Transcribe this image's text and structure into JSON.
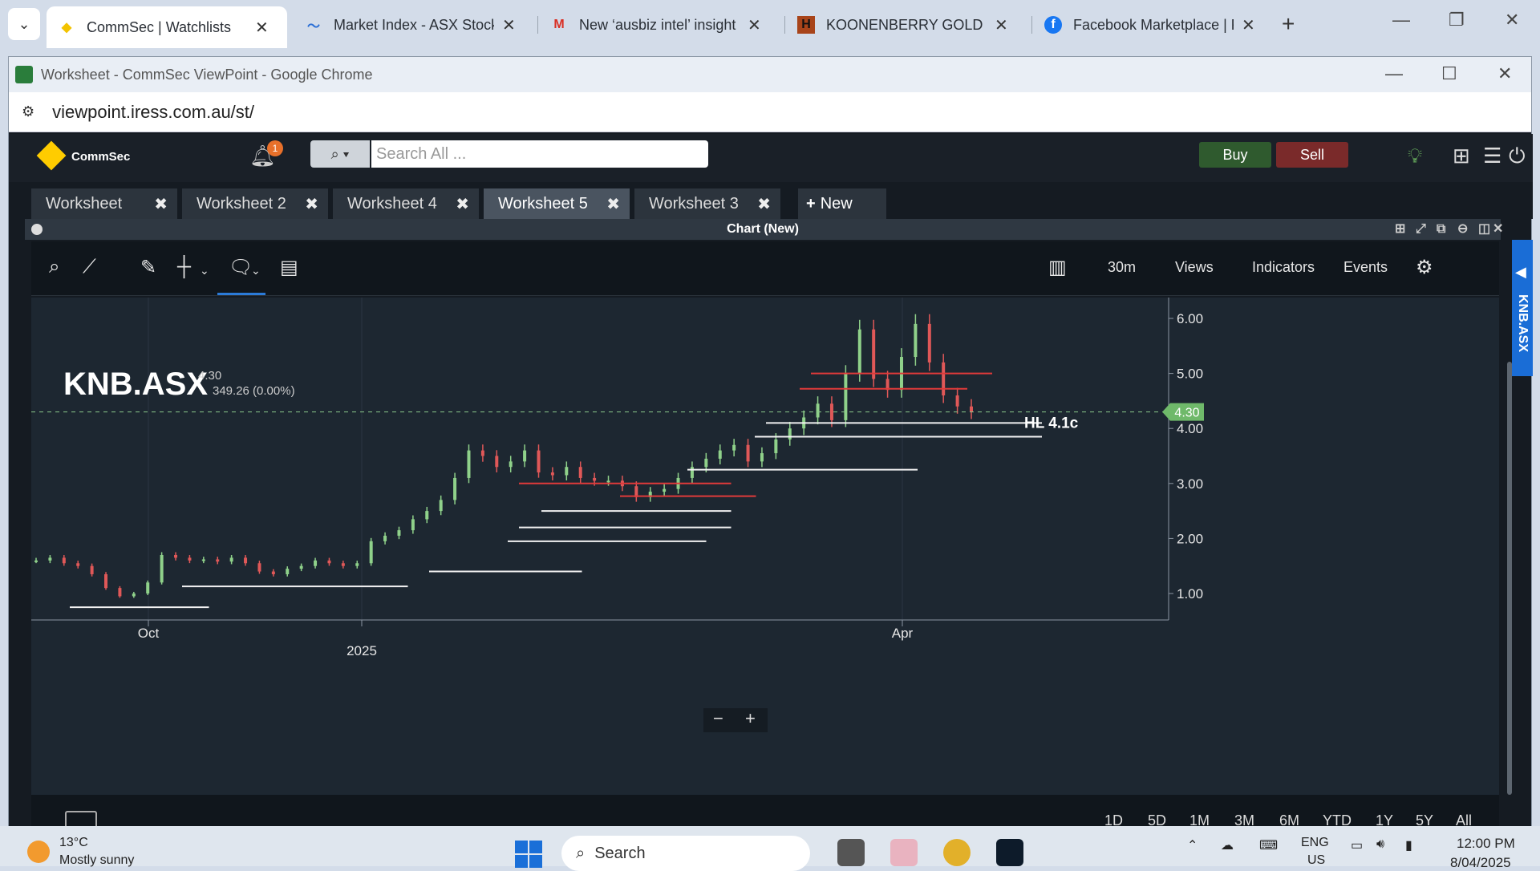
{
  "browser_tabs": [
    {
      "title": "CommSec | Watchlists",
      "icon": "commsec-diamond-icon"
    },
    {
      "title": "Market Index - ASX Stock",
      "icon": "market-index-icon"
    },
    {
      "title": "New ‘ausbiz intel’ insight",
      "icon": "gmail-icon"
    },
    {
      "title": "KOONENBERRY GOLD LIM",
      "icon": "hotcopper-icon"
    },
    {
      "title": "Facebook Marketplace | F",
      "icon": "facebook-icon"
    }
  ],
  "window": {
    "title": "Worksheet - CommSec ViewPoint - Google Chrome",
    "url": "viewpoint.iress.com.au/st/"
  },
  "app": {
    "brand": "CommSec",
    "notification_count": "1",
    "search_placeholder": "Search All ...",
    "buy_label": "Buy",
    "sell_label": "Sell"
  },
  "worksheets": [
    {
      "label": "Worksheet",
      "active": false
    },
    {
      "label": "Worksheet 2",
      "active": false
    },
    {
      "label": "Worksheet 4",
      "active": false
    },
    {
      "label": "Worksheet 5",
      "active": true
    },
    {
      "label": "Worksheet 3",
      "active": false
    }
  ],
  "new_worksheet_label": "New",
  "panel_title": "Chart (New)",
  "toolbar": {
    "interval": "30m",
    "views": "Views",
    "indicators": "Indicators",
    "events": "Events"
  },
  "symbol": {
    "code": "KNB.ASX",
    "price": "4.30",
    "change": "349.26 (0.00%)",
    "side_tab": "KNB.ASX"
  },
  "chart_data": {
    "type": "candlestick",
    "y_ticks": [
      "6.00",
      "5.00",
      "4.00",
      "3.00",
      "2.00",
      "1.00"
    ],
    "ylim": [
      0.45,
      6.3
    ],
    "x_ticks": [
      "Oct",
      "2025",
      "Apr"
    ],
    "last_price": 4.3,
    "last_price_label": "4.30",
    "annotation": "HL 4.1c",
    "closes": [
      1.6,
      1.65,
      1.55,
      1.5,
      1.35,
      1.1,
      0.95,
      1.0,
      1.2,
      1.7,
      1.65,
      1.6,
      1.62,
      1.58,
      1.65,
      1.55,
      1.4,
      1.35,
      1.45,
      1.5,
      1.6,
      1.55,
      1.5,
      1.55,
      1.95,
      2.05,
      2.15,
      2.35,
      2.5,
      2.7,
      3.1,
      3.6,
      3.5,
      3.3,
      3.4,
      3.6,
      3.2,
      3.15,
      3.3,
      3.1,
      3.05,
      3.05,
      2.95,
      2.75,
      2.85,
      2.9,
      3.1,
      3.3,
      3.45,
      3.6,
      3.7,
      3.4,
      3.55,
      3.8,
      4.0,
      4.2,
      4.45,
      4.15,
      5.0,
      5.8,
      4.9,
      4.7,
      5.3,
      5.9,
      5.2,
      4.6,
      4.4,
      4.3
    ],
    "support_lines_white": [
      {
        "from": "2024-09",
        "to": "2024-10",
        "price": 0.75
      },
      {
        "from": "2024-10",
        "to": "2024-12",
        "price": 1.13
      },
      {
        "from": "2025-01",
        "to": "2025-02",
        "price": 1.4
      },
      {
        "from": "2025-02",
        "to": "2025-02",
        "price": 1.95
      },
      {
        "from": "2025-02",
        "to": "2025-03",
        "price": 2.2
      },
      {
        "from": "2025-03",
        "to": "2025-03",
        "price": 2.5
      },
      {
        "from": "2025-03",
        "to": "2025-04",
        "price": 3.25
      },
      {
        "from": "2025-04",
        "to": "2025-04",
        "price": 3.85
      },
      {
        "from": "2025-04",
        "to": "2025-04",
        "price": 4.1
      }
    ],
    "resistance_lines_red": [
      {
        "from": "2025-02",
        "to": "2025-03",
        "price": 3.0
      },
      {
        "from": "2025-03",
        "to": "2025-03",
        "price": 2.77
      },
      {
        "from": "2025-04",
        "to": "2025-04",
        "price": 4.72
      },
      {
        "from": "2025-04",
        "to": "2025-04",
        "price": 5.0
      }
    ]
  },
  "ranges": [
    "1D",
    "5D",
    "1M",
    "3M",
    "6M",
    "YTD",
    "1Y",
    "5Y",
    "All"
  ],
  "taskbar": {
    "temp": "13°C",
    "weather": "Mostly sunny",
    "search": "Search",
    "lang1": "ENG",
    "lang2": "US",
    "time": "12:00 PM",
    "date": "8/04/2025"
  },
  "colors": {
    "bg": "#1d2731",
    "up": "#8fd18a",
    "down": "#e05858",
    "accent": "#1a6dd6",
    "price_tag": "#6fb96a"
  }
}
